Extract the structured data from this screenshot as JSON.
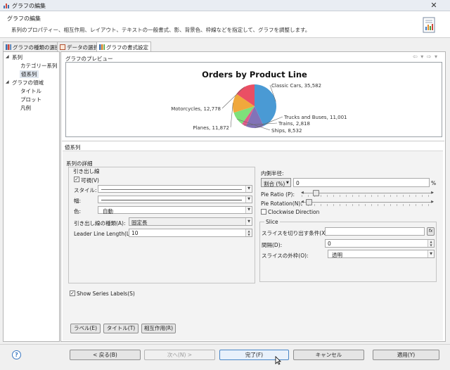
{
  "window": {
    "title": "グラフの編集",
    "close_glyph": "✕"
  },
  "header": {
    "title": "グラフの編集",
    "description": "系列のプロパティー、相互作用、レイアウト、テキストの一般書式、影、背景色、枠線などを指定して、グラフを調整します。"
  },
  "tabs": [
    {
      "label": "グラフの種類の選択",
      "active": false
    },
    {
      "label": "データの選択",
      "active": false
    },
    {
      "label": "グラフの書式設定",
      "active": true
    }
  ],
  "tree": {
    "items": [
      {
        "label": "系列",
        "expanded": true,
        "selected": false
      },
      {
        "label": "カテゴリー系列",
        "selected": false
      },
      {
        "label": "値系列",
        "selected": true
      },
      {
        "label": "グラフの領域",
        "expanded": true,
        "selected": false
      },
      {
        "label": "タイトル",
        "selected": false
      },
      {
        "label": "プロット",
        "selected": false
      },
      {
        "label": "凡例",
        "selected": false
      }
    ]
  },
  "preview": {
    "label": "グラフのプレビュー",
    "nav_icons": "⇦ ▾ ⇨ ▾"
  },
  "chart_data": {
    "type": "pie",
    "title": "Orders by Product Line",
    "slices": [
      {
        "label": "Classic Cars",
        "value": 35582,
        "display": "Classic Cars, 35,582",
        "color": "#4a9ad4"
      },
      {
        "label": "Trucks and Buses",
        "value": 11001,
        "display": "Trucks and Buses, 11,001",
        "color": "#8273b8"
      },
      {
        "label": "Trains",
        "value": 2818,
        "display": "Trains, 2,818",
        "color": "#e05a8a"
      },
      {
        "label": "Ships",
        "value": 8532,
        "display": "Ships, 8,532",
        "color": "#7ee07a"
      },
      {
        "label": "Planes",
        "value": 11872,
        "display": "Planes, 11,872",
        "color": "#f0a83c"
      },
      {
        "label": "Motorcycles",
        "value": 12778,
        "display": "Motorcycles, 12,778",
        "color": "#ea4f64"
      }
    ]
  },
  "series_section": {
    "label": "値系列"
  },
  "details": {
    "label": "系列の詳細",
    "leader": {
      "label": "引き出し線",
      "visible_label": "可視(V)",
      "visible_checked": true,
      "style_label": "スタイル:",
      "width_label": "幅:",
      "color_label": "色:",
      "color_value": "自動",
      "type_label": "引き出し線の種類(A):",
      "type_value": "固定長",
      "length_label": "Leader Line Length(L):",
      "length_value": "10"
    },
    "inner": {
      "label": "内側半径:",
      "mode_value": "割合 (%)",
      "radius_value": "0",
      "unit": "%",
      "pie_ratio_label": "Pie Ratio (P):",
      "pie_ratio_level": 0.06,
      "pie_rotation_label": "Pie Rotation(N):",
      "pie_rotation_level": 0.0,
      "clockwise_label": "Clockwise Direction",
      "clockwise_checked": false
    },
    "slice": {
      "label": "Slice",
      "condition_label": "スライスを切り出す条件(X):",
      "condition_value": "",
      "fx_label": "fx",
      "distance_label": "間隔(D):",
      "distance_value": "0",
      "outline_label": "スライスの外枠(O):",
      "outline_value": "透明"
    },
    "show_labels": {
      "label": "Show Series Labels(S)",
      "checked": true
    },
    "buttons": {
      "labels": "ラベル(E)",
      "title": "タイトル(T)",
      "interact": "相互作用(R)"
    }
  },
  "footer": {
    "help": "?",
    "back": "< 戻る(B)",
    "next": "次へ(N) >",
    "finish": "完了(F)",
    "cancel": "キャンセル",
    "apply": "適用(Y)"
  },
  "colors": {
    "accent": "#4a86c7",
    "help": "#3a78c2"
  }
}
